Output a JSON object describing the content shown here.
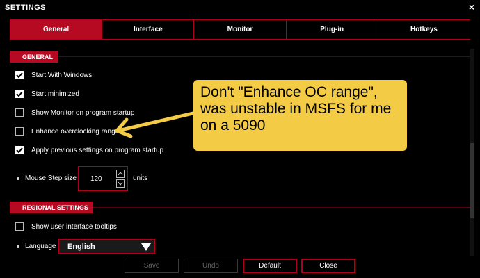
{
  "window": {
    "title": "SETTINGS",
    "close": "×"
  },
  "tabs": [
    {
      "label": "General",
      "active": true
    },
    {
      "label": "Interface",
      "active": false
    },
    {
      "label": "Monitor",
      "active": false
    },
    {
      "label": "Plug-in",
      "active": false
    },
    {
      "label": "Hotkeys",
      "active": false
    }
  ],
  "general": {
    "header": "GENERAL",
    "options": [
      {
        "label": "Start With Windows",
        "checked": true
      },
      {
        "label": "Start minimized",
        "checked": true
      },
      {
        "label": "Show Monitor on program startup",
        "checked": false
      },
      {
        "label": "Enhance overclocking range",
        "checked": false
      },
      {
        "label": "Apply previous settings on program startup",
        "checked": true
      }
    ],
    "mouse_step": {
      "label": "Mouse Step size",
      "value": "120",
      "units": "units"
    }
  },
  "regional": {
    "header": "REGIONAL SETTINGS",
    "tooltips": {
      "label": "Show user interface tooltips",
      "checked": false
    },
    "language": {
      "label": "Language",
      "value": "English"
    }
  },
  "buttons": {
    "save": "Save",
    "undo": "Undo",
    "default": "Default",
    "close": "Close"
  },
  "callout": {
    "text": "Don't \"Enhance OC range\", was unstable in MSFS for me on a 5090",
    "color": "#f4cb45"
  },
  "colors": {
    "accent": "#b50a22"
  }
}
